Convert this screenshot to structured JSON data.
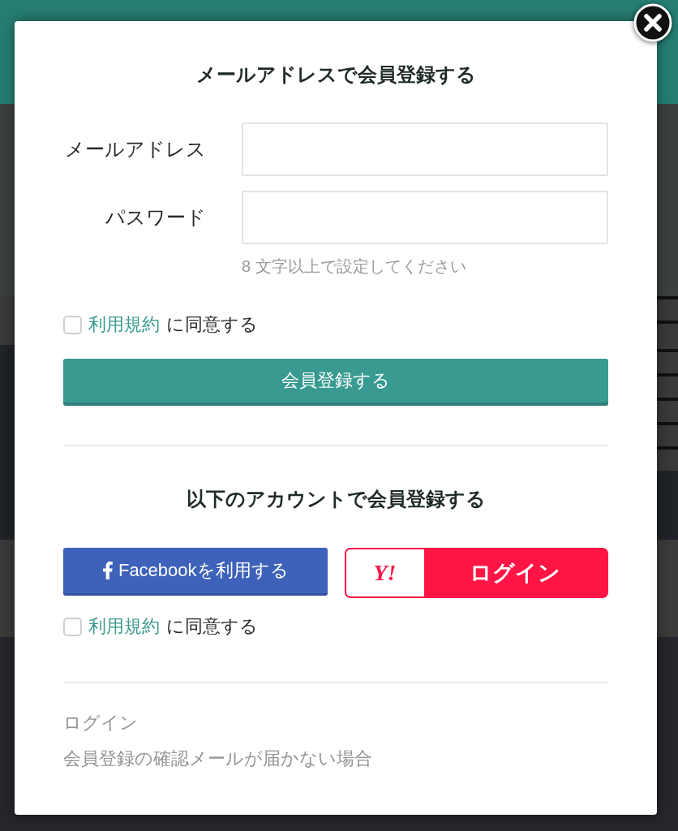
{
  "email_signup": {
    "title": "メールアドレスで会員登録する",
    "fields": [
      {
        "label": "メールアドレス"
      },
      {
        "label": "パスワード",
        "hint": "8 文字以上で設定してください"
      }
    ],
    "terms": {
      "checked": false,
      "link": "利用規約",
      "text": "に同意する"
    },
    "submit": "会員登録する"
  },
  "social_signup": {
    "title": "以下のアカウントで会員登録する",
    "buttons": [
      {
        "kind": "facebook",
        "label": "Facebookを利用する"
      },
      {
        "kind": "yahoo",
        "logo": "Y!",
        "label": "ログイン"
      }
    ],
    "terms": {
      "checked": false,
      "link": "利用規約",
      "text": "に同意する"
    }
  },
  "footer_links": [
    "ログイン",
    "会員登録の確認メールが届かない場合"
  ]
}
